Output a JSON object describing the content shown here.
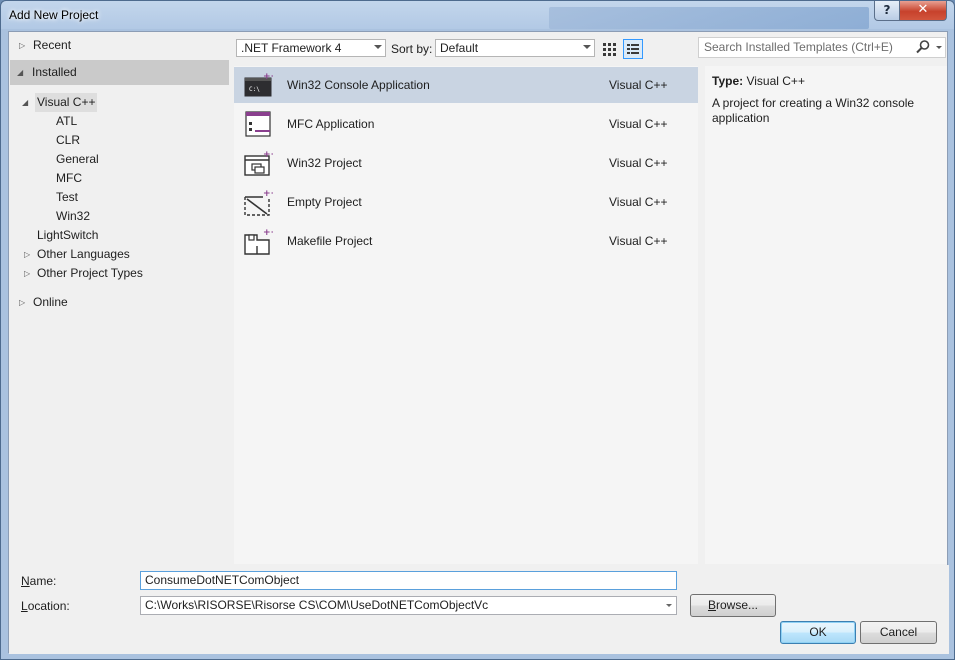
{
  "window": {
    "title": "Add New Project",
    "help_glyph": "?",
    "close_glyph": "✕"
  },
  "tree": {
    "items": [
      {
        "label": "Recent",
        "expander": "▷"
      },
      {
        "label": "Installed",
        "expander": "◢"
      },
      {
        "label": "Visual C++",
        "expander": "◢"
      },
      {
        "label": "ATL"
      },
      {
        "label": "CLR"
      },
      {
        "label": "General"
      },
      {
        "label": "MFC"
      },
      {
        "label": "Test"
      },
      {
        "label": "Win32"
      },
      {
        "label": "LightSwitch"
      },
      {
        "label": "Other Languages",
        "expander": "▷"
      },
      {
        "label": "Other Project Types",
        "expander": "▷"
      },
      {
        "label": "Online",
        "expander": "▷"
      }
    ]
  },
  "toolbar": {
    "framework": ".NET Framework 4",
    "sort_label": "Sort by:",
    "sort_value": "Default"
  },
  "search": {
    "placeholder": "Search Installed Templates (Ctrl+E)"
  },
  "templates": [
    {
      "name": "Win32 Console Application",
      "language": "Visual C++",
      "icon": "console-app-icon"
    },
    {
      "name": "MFC Application",
      "language": "Visual C++",
      "icon": "mfc-app-icon"
    },
    {
      "name": "Win32 Project",
      "language": "Visual C++",
      "icon": "win32-project-icon"
    },
    {
      "name": "Empty Project",
      "language": "Visual C++",
      "icon": "empty-project-icon"
    },
    {
      "name": "Makefile Project",
      "language": "Visual C++",
      "icon": "makefile-project-icon"
    }
  ],
  "details": {
    "type_label": "Type:",
    "type_value": "Visual C++",
    "description": "A project for creating a Win32 console application"
  },
  "form": {
    "name_label_hotkey": "N",
    "name_label_rest": "ame:",
    "name_value": "ConsumeDotNETComObject",
    "location_label_hotkey": "L",
    "location_label_rest": "ocation:",
    "location_value": "C:\\Works\\RISORSE\\Risorse CS\\COM\\UseDotNETComObjectVc",
    "browse_hotkey": "B",
    "browse_rest": "rowse...",
    "ok_label": "OK",
    "cancel_label": "Cancel"
  },
  "colors": {
    "selected_row": "#c9d4e2",
    "installed_header": "#cacaca",
    "icon_purple": "#8a3f8e",
    "focus_border": "#5aa0dc"
  }
}
